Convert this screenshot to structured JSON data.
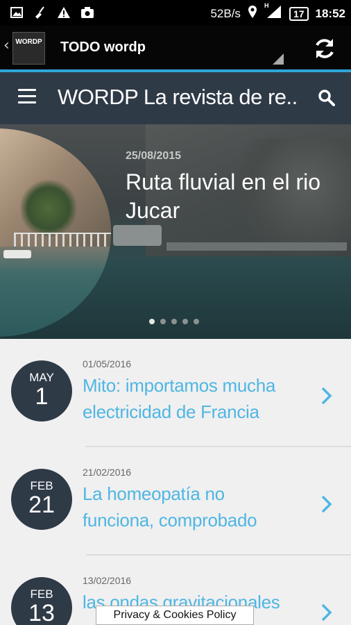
{
  "status_bar": {
    "speed": "52B/s",
    "network": "H",
    "battery": "17",
    "time": "18:52",
    "left_icons": [
      "image-icon",
      "broom-icon",
      "warning-icon",
      "camera-icon"
    ]
  },
  "action_bar": {
    "logo_text": "WORDP",
    "title": "TODO wordp"
  },
  "site_header": {
    "title": "WORDP La revista de re..."
  },
  "hero": {
    "date": "25/08/2015",
    "title": "Ruta fluvial en el rio Jucar",
    "slides": 5,
    "active_slide": 0
  },
  "posts": [
    {
      "month": "MAY",
      "day": "1",
      "date": "01/05/2016",
      "title": "Mito: importamos mucha electricidad de Francia"
    },
    {
      "month": "FEB",
      "day": "21",
      "date": "21/02/2016",
      "title": "La homeopatía no funciona, comprobado"
    },
    {
      "month": "FEB",
      "day": "13",
      "date": "13/02/2016",
      "title": "las ondas gravitacionales"
    }
  ],
  "privacy_label": "Privacy & Cookies Policy",
  "colors": {
    "accent": "#2fa6d9",
    "header_bg": "#2f3a47",
    "link": "#4fb6e3"
  }
}
